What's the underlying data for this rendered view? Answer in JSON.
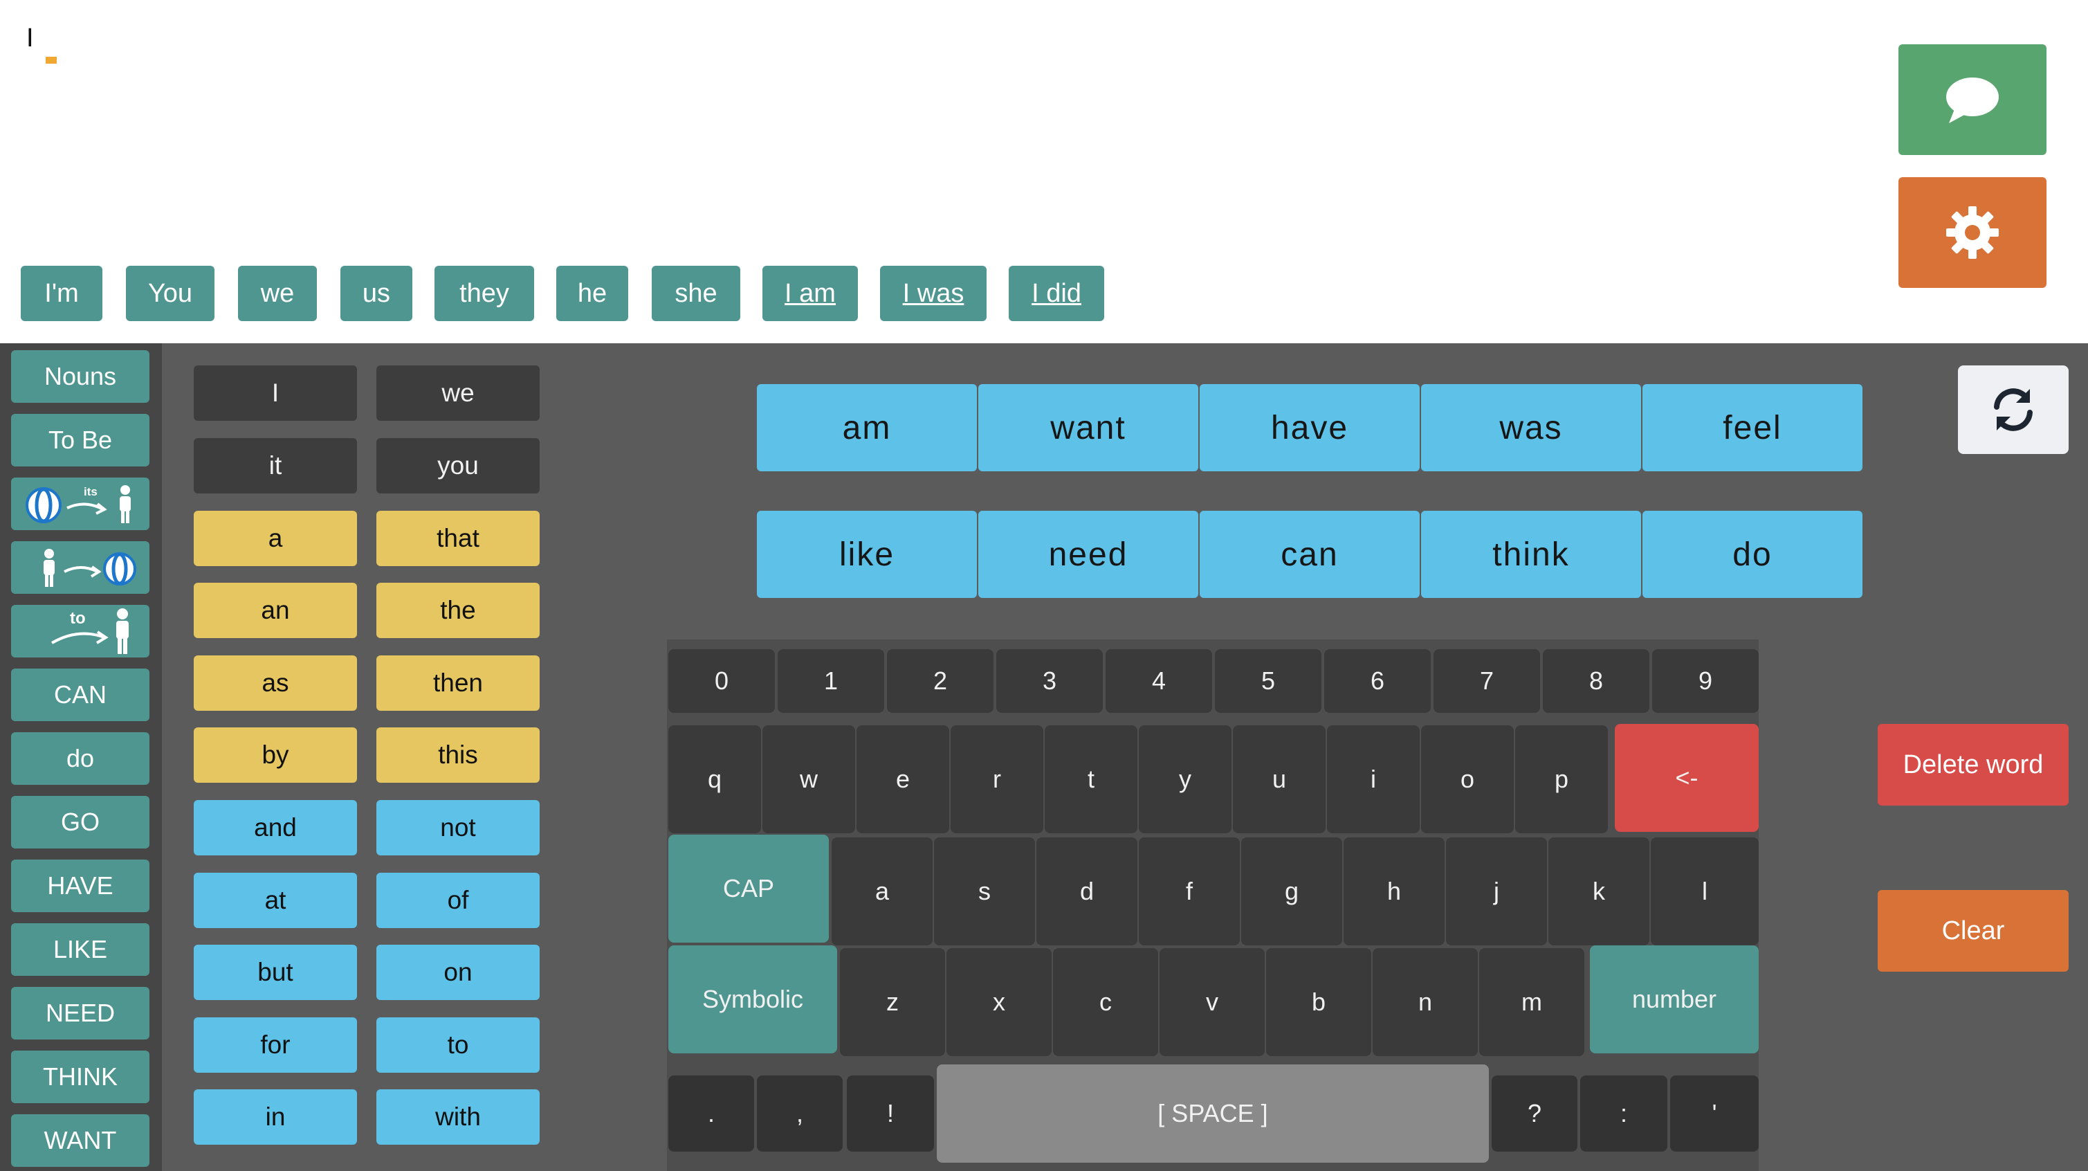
{
  "output": {
    "text": "I"
  },
  "suggestions": [
    "I'm",
    "You",
    "we",
    "us",
    "they",
    "he",
    "she",
    "I am",
    "I was",
    "I did"
  ],
  "sidebar": {
    "items": [
      "Nouns",
      "To Be",
      "",
      "",
      "",
      "CAN",
      "do",
      "GO",
      "HAVE",
      "LIKE",
      "NEED",
      "THINK",
      "WANT"
    ],
    "icon_labels": {
      "its": "its",
      "to": "to"
    }
  },
  "words": {
    "col1": [
      "I",
      "it",
      "a",
      "an",
      "as",
      "by",
      "and",
      "at",
      "but",
      "for",
      "in"
    ],
    "col2": [
      "we",
      "you",
      "that",
      "the",
      "then",
      "this",
      "not",
      "of",
      "on",
      "to",
      "with"
    ]
  },
  "verbs": {
    "row1": [
      "am",
      "want",
      "have",
      "was",
      "feel"
    ],
    "row2": [
      "like",
      "need",
      "can",
      "think",
      "do"
    ]
  },
  "keyboard": {
    "numbers": [
      "0",
      "1",
      "2",
      "3",
      "4",
      "5",
      "6",
      "7",
      "8",
      "9"
    ],
    "row1": [
      "q",
      "w",
      "e",
      "r",
      "t",
      "y",
      "u",
      "i",
      "o",
      "p"
    ],
    "backspace": "<-",
    "cap": "CAP",
    "row2": [
      "a",
      "s",
      "d",
      "f",
      "g",
      "h",
      "j",
      "k",
      "l"
    ],
    "symbolic": "Symbolic",
    "row3": [
      "z",
      "x",
      "c",
      "v",
      "b",
      "n",
      "m"
    ],
    "number": "number",
    "punct_left": [
      ".",
      ",",
      "!"
    ],
    "space": "[ SPACE ]",
    "punct_right": [
      "?",
      ":",
      "'"
    ]
  },
  "actions": {
    "delete_word": "Delete word",
    "clear": "Clear"
  },
  "icons": {
    "speak": "speech-bubble-icon",
    "settings": "gear-icon",
    "refresh": "refresh-icon"
  },
  "colors": {
    "teal": "#4f9690",
    "green": "#58a56f",
    "orange": "#d97236",
    "red": "#d74b48",
    "blue": "#5ec1e8",
    "yellow": "#e5c660"
  }
}
